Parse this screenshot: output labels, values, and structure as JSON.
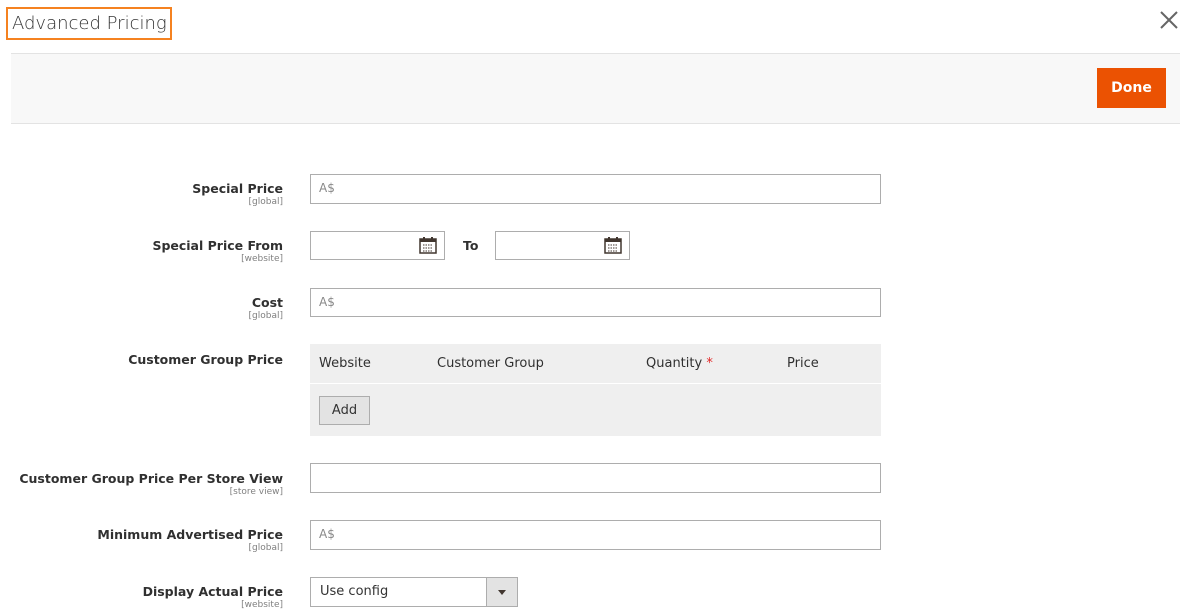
{
  "modal": {
    "title": "Advanced Pricing",
    "close_icon": "close-icon",
    "done_label": "Done",
    "accent": "#eb5202",
    "highlight": "#f58220"
  },
  "fields": {
    "special_price": {
      "label": "Special Price",
      "scope": "[global]",
      "placeholder": "A$"
    },
    "special_price_from": {
      "label": "Special Price From",
      "scope": "[website]",
      "to_label": "To",
      "from_value": "",
      "to_value": ""
    },
    "cost": {
      "label": "Cost",
      "scope": "[global]",
      "placeholder": "A$"
    },
    "customer_group_price": {
      "label": "Customer Group Price",
      "columns": [
        "Website",
        "Customer Group",
        "Quantity",
        "Price"
      ],
      "required_mark": "*",
      "add_label": "Add"
    },
    "customer_group_price_store": {
      "label": "Customer Group Price Per Store View",
      "scope": "[store view]",
      "value": ""
    },
    "map": {
      "label": "Minimum Advertised Price",
      "scope": "[global]",
      "placeholder": "A$"
    },
    "display_actual_price": {
      "label": "Display Actual Price",
      "scope": "[website]",
      "value": "Use config"
    }
  }
}
